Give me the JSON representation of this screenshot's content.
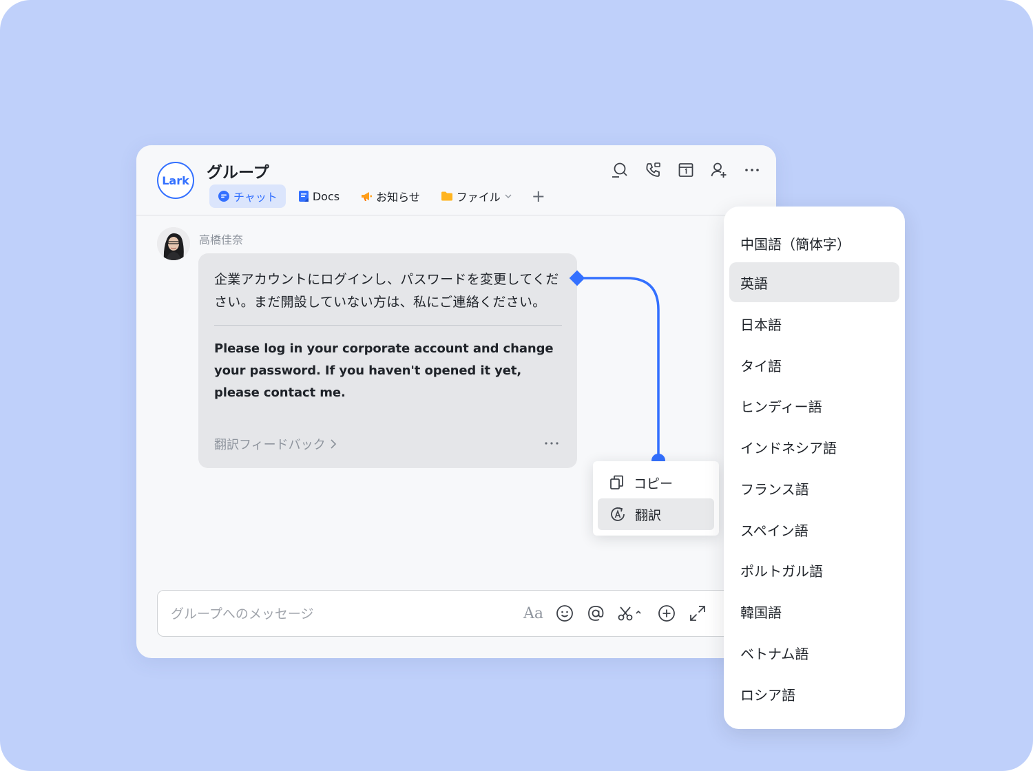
{
  "app": {
    "logo_text": "Lark"
  },
  "header": {
    "title": "グループ",
    "tabs": [
      {
        "label": "チャット",
        "icon": "chat-bubble-icon",
        "active": true
      },
      {
        "label": "Docs",
        "icon": "docs-icon",
        "active": false
      },
      {
        "label": "お知らせ",
        "icon": "megaphone-icon",
        "active": false
      },
      {
        "label": "ファイル",
        "icon": "folder-icon",
        "active": false
      }
    ],
    "add_tab_label": "+",
    "actions": [
      "search-chat-icon",
      "call-icon",
      "calendar-icon",
      "add-member-icon",
      "more-icon"
    ]
  },
  "message": {
    "sender": "高橋佳奈",
    "original_text": "企業アカウントにログインし、パスワードを変更してください。まだ開設していない方は、私にご連絡ください。",
    "translated_text": "Please log in your corporate account and change your password. If you haven't opened it yet, please contact me.",
    "feedback_label": "翻訳フィードバック"
  },
  "context_menu": {
    "items": [
      {
        "label": "コピー",
        "icon": "copy-icon"
      },
      {
        "label": "翻訳",
        "icon": "translate-icon"
      }
    ]
  },
  "composer": {
    "placeholder": "グループへのメッセージ",
    "format_label": "Aa"
  },
  "languages": {
    "selected": "英語",
    "items": [
      "中国語（簡体字）",
      "英語",
      "日本語",
      "タイ語",
      "ヒンディー語",
      "インドネシア語",
      "フランス語",
      "スペイン語",
      "ポルトガル語",
      "韓国語",
      "ベトナム語",
      "ロシア語"
    ]
  },
  "colors": {
    "background": "#bfd0fa",
    "accent": "#3370ff",
    "selected_row": "#e8e9eb",
    "bubble": "#e5e6e9"
  }
}
